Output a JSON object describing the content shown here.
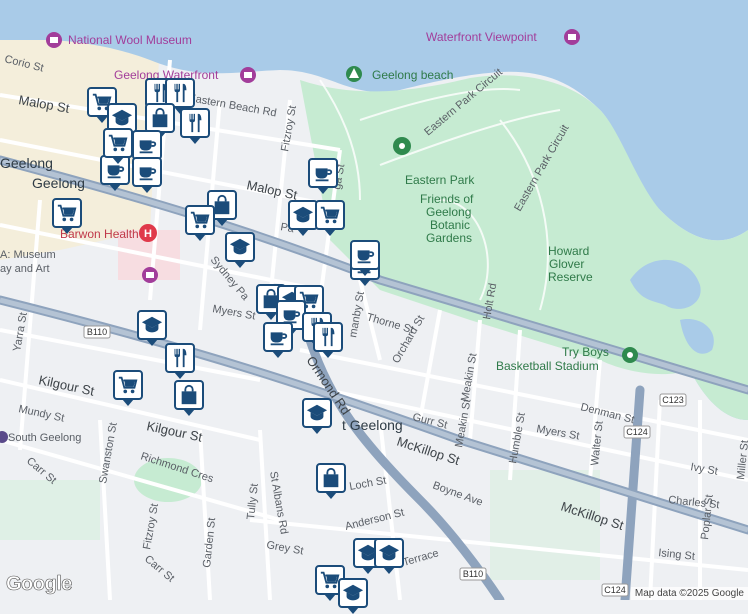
{
  "map": {
    "places": {
      "national_wool_museum": "National Wool Museum",
      "waterfront_viewpoint": "Waterfront Viewpoint",
      "geelong_beach": "Geelong beach",
      "geelong_waterfront": "Geelong Waterfront",
      "eastern_park": "Eastern Park",
      "botanic_gardens": [
        "Friends of",
        "Geelong",
        "Botanic",
        "Gardens"
      ],
      "howard_glover": [
        "Howard",
        "Glover",
        "Reserve"
      ],
      "barwon_health": "Barwon Health",
      "museum_art": [
        "A: Museum",
        "ay and Art"
      ],
      "try_boys": [
        "Try Boys",
        "Basketball Stadium"
      ],
      "geelong_1": "Geelong",
      "geelong_2": "Geelong",
      "east_geelong": "t Geelong",
      "south_geelong": "South Geelong"
    },
    "streets": {
      "corio": "Corio St",
      "malop_w": "Malop St",
      "malop_e": "Malop St",
      "eastern_beach_rd": "Eastern Beach Rd",
      "fitzroy": "Fitzroy St",
      "eastern_park_circuit_1": "Eastern Park Circuit",
      "eastern_park_circuit_2": "Eastern Park Circuit",
      "sydney_pde": "Sydney Pa",
      "myers_w": "Myers St",
      "myers_e": "Myers St",
      "thorne": "Thorne St",
      "orchard": "Orchard St",
      "holt_rd": "Holt Rd",
      "meakin_1": "Meakin St",
      "meakin_2": "Meakin St",
      "denman": "Denman St",
      "gurr": "Gurr St",
      "ormond_rd": "Ormond Rd",
      "mckillop_w": "McKillop St",
      "mckillop_e": "McKillop St",
      "kilgour_1": "Kilgour St",
      "kilgour_2": "Kilgour St",
      "mundy": "Mundy St",
      "yarra": "Yarra St",
      "swanston": "Swanston St",
      "richmond_cres": "Richmond Cres",
      "carr_1": "Carr St",
      "carr_2": "Carr St",
      "fitzroy_s": "Fitzroy St",
      "garden": "Garden St",
      "tully": "Tully St",
      "st_albans": "St Albans Rd",
      "grey": "Grey St",
      "loch": "Loch St",
      "anderson": "Anderson St",
      "boyne": "Boyne Ave",
      "humble": "Humble St",
      "walter": "Walter St",
      "ivy": "Ivy St",
      "charles": "Charles St",
      "ising": "Ising St",
      "poplar": "Poplar St",
      "miller": "Miller St",
      "terrace": "Terrace",
      "lamby": "manby St",
      "ga": "ga St",
      "pa": "Pa"
    },
    "route_shields": [
      "B110",
      "B110",
      "C123",
      "C124",
      "C124"
    ],
    "attribution": "Map data ©2025 Google",
    "logo": "Google"
  },
  "colors": {
    "water": "#a9cbe8",
    "park": "#c6ebd2",
    "marker_border": "#1b4c7a",
    "road_major": "#8ea3bd"
  },
  "markers": [
    {
      "icon": "coffee-icon",
      "label": "cafe"
    },
    {
      "icon": "cart-icon",
      "label": "supermarket"
    },
    {
      "icon": "bag-icon",
      "label": "shopping"
    },
    {
      "icon": "cutlery-icon",
      "label": "restaurant"
    },
    {
      "icon": "school-icon",
      "label": "school"
    }
  ]
}
